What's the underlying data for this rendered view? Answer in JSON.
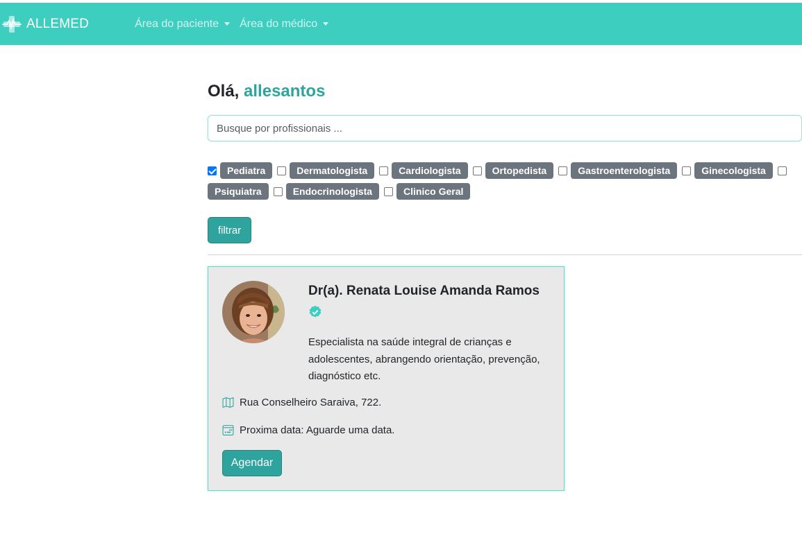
{
  "navbar": {
    "brand": "ALLEMED",
    "menu": [
      {
        "label": "Área do paciente"
      },
      {
        "label": "Área do médico"
      }
    ],
    "colors": {
      "background": "#3ecec0",
      "text": "#ffffff"
    }
  },
  "greeting": {
    "prefix": "Olá,",
    "username": "allesantos"
  },
  "search": {
    "placeholder": "Busque por profissionais ...",
    "value": ""
  },
  "filters": {
    "items": [
      {
        "label": "Pediatra",
        "checked": true
      },
      {
        "label": "Dermatologista",
        "checked": false
      },
      {
        "label": "Cardiologista",
        "checked": false
      },
      {
        "label": "Ortopedista",
        "checked": false
      },
      {
        "label": "Gastroenterologista",
        "checked": false
      },
      {
        "label": "Ginecologista",
        "checked": false
      },
      {
        "label": "Psiquiatra",
        "checked": false
      },
      {
        "label": "Endocrinologista",
        "checked": false
      },
      {
        "label": "Clinico Geral",
        "checked": false
      }
    ],
    "button_label": "filtrar"
  },
  "doctor_card": {
    "name": "Dr(a). Renata Louise Amanda Ramos",
    "verified": true,
    "verified_icon": "verified-check-icon",
    "description": "Especialista na saúde integral de crianças e adolescentes, abrangendo orientação, prevenção, diagnóstico etc.",
    "address_icon": "map-icon",
    "address": "Rua Conselheiro Saraiva, 722.",
    "date_icon": "calendar-icon",
    "next_date": "Proxima data: Aguarde uma data.",
    "button_label": "Agendar"
  },
  "colors": {
    "accent": "#2fa39d",
    "navbar": "#3ecec0",
    "badge": "#6c757d",
    "card_background": "#e9e9ea"
  }
}
